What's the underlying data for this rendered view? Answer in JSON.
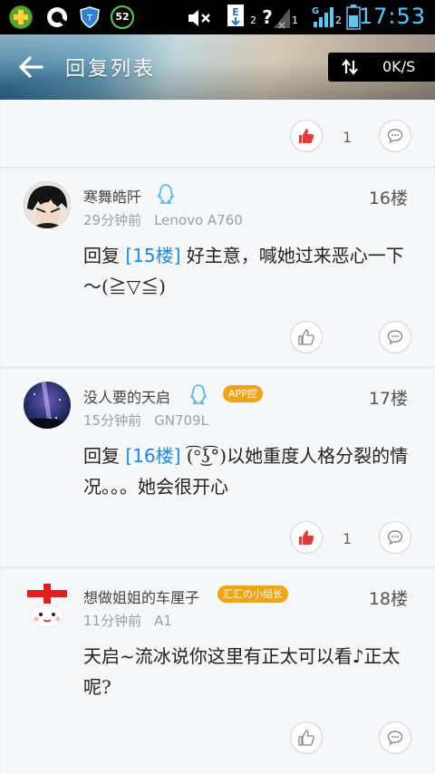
{
  "status_bar": {
    "time": "17:53",
    "battery_badge": "52",
    "sim1_label": "2",
    "sim2_label": "1",
    "signal_label": "2"
  },
  "header": {
    "title": "回复列表",
    "net_speed": "0K/S"
  },
  "top_actions": {
    "like_count": "1",
    "liked": true
  },
  "replies": [
    {
      "username": "寒舞皓阡",
      "time": "29分钟前",
      "device": "Lenovo A760",
      "floor": "16楼",
      "reply_prefix": "回复",
      "reply_ref": "[15楼]",
      "reply_text": "好主意，喊她过来恶心一下～(≧▽≦)",
      "badge": "",
      "liked": false,
      "like_count": ""
    },
    {
      "username": "没人要的天启",
      "time": "15分钟前",
      "device": "GN709L",
      "floor": "17楼",
      "reply_prefix": "回复",
      "reply_ref": "[16楼]",
      "reply_text": "(͡°͜ʖ͡°)以她重度人格分裂的情况。。。她会很开心",
      "badge": "APP控",
      "liked": true,
      "like_count": "1"
    },
    {
      "username": "想做姐姐的车厘子",
      "time": "11分钟前",
      "device": "A1",
      "floor": "18楼",
      "reply_prefix": "",
      "reply_ref": "",
      "reply_text": "天启~流冰说你这里有正太可以看♪正太呢?",
      "badge": "汇汇の小组长",
      "liked": false,
      "like_count": ""
    }
  ],
  "colors": {
    "accent_blue": "#1e88e5",
    "like_red": "#e53935",
    "badge_orange": "#f0a516",
    "time_blue": "#5ac8fa"
  }
}
